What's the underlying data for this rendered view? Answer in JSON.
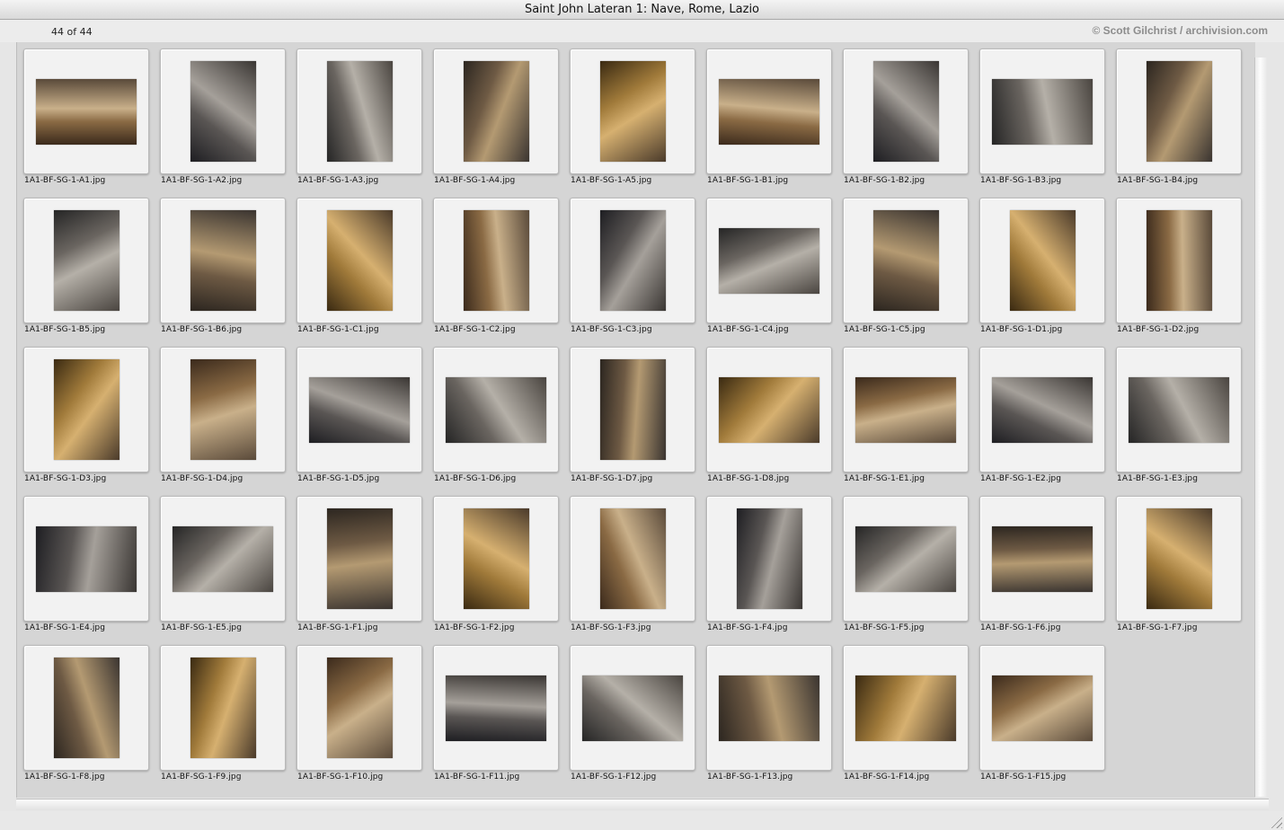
{
  "window": {
    "title": "Saint John Lateran 1: Nave, Rome, Lazio"
  },
  "header": {
    "count": "44 of 44",
    "credit": "© Scott Gilchrist / archivision.com"
  },
  "thumbnails": [
    {
      "file": "1A1-BF-SG-1-A1.jpg",
      "orientation": "landscape"
    },
    {
      "file": "1A1-BF-SG-1-A2.jpg",
      "orientation": "portrait"
    },
    {
      "file": "1A1-BF-SG-1-A3.jpg",
      "orientation": "portrait"
    },
    {
      "file": "1A1-BF-SG-1-A4.jpg",
      "orientation": "portrait"
    },
    {
      "file": "1A1-BF-SG-1-A5.jpg",
      "orientation": "portrait"
    },
    {
      "file": "1A1-BF-SG-1-B1.jpg",
      "orientation": "landscape"
    },
    {
      "file": "1A1-BF-SG-1-B2.jpg",
      "orientation": "portrait"
    },
    {
      "file": "1A1-BF-SG-1-B3.jpg",
      "orientation": "landscape"
    },
    {
      "file": "1A1-BF-SG-1-B4.jpg",
      "orientation": "portrait"
    },
    {
      "file": "1A1-BF-SG-1-B5.jpg",
      "orientation": "portrait"
    },
    {
      "file": "1A1-BF-SG-1-B6.jpg",
      "orientation": "portrait"
    },
    {
      "file": "1A1-BF-SG-1-C1.jpg",
      "orientation": "portrait"
    },
    {
      "file": "1A1-BF-SG-1-C2.jpg",
      "orientation": "portrait"
    },
    {
      "file": "1A1-BF-SG-1-C3.jpg",
      "orientation": "portrait"
    },
    {
      "file": "1A1-BF-SG-1-C4.jpg",
      "orientation": "landscape"
    },
    {
      "file": "1A1-BF-SG-1-C5.jpg",
      "orientation": "portrait"
    },
    {
      "file": "1A1-BF-SG-1-D1.jpg",
      "orientation": "portrait"
    },
    {
      "file": "1A1-BF-SG-1-D2.jpg",
      "orientation": "portrait"
    },
    {
      "file": "1A1-BF-SG-1-D3.jpg",
      "orientation": "portrait"
    },
    {
      "file": "1A1-BF-SG-1-D4.jpg",
      "orientation": "portrait"
    },
    {
      "file": "1A1-BF-SG-1-D5.jpg",
      "orientation": "landscape"
    },
    {
      "file": "1A1-BF-SG-1-D6.jpg",
      "orientation": "landscape"
    },
    {
      "file": "1A1-BF-SG-1-D7.jpg",
      "orientation": "portrait"
    },
    {
      "file": "1A1-BF-SG-1-D8.jpg",
      "orientation": "landscape"
    },
    {
      "file": "1A1-BF-SG-1-E1.jpg",
      "orientation": "landscape"
    },
    {
      "file": "1A1-BF-SG-1-E2.jpg",
      "orientation": "landscape"
    },
    {
      "file": "1A1-BF-SG-1-E3.jpg",
      "orientation": "landscape"
    },
    {
      "file": "1A1-BF-SG-1-E4.jpg",
      "orientation": "landscape"
    },
    {
      "file": "1A1-BF-SG-1-E5.jpg",
      "orientation": "landscape"
    },
    {
      "file": "1A1-BF-SG-1-F1.jpg",
      "orientation": "portrait"
    },
    {
      "file": "1A1-BF-SG-1-F2.jpg",
      "orientation": "portrait"
    },
    {
      "file": "1A1-BF-SG-1-F3.jpg",
      "orientation": "portrait"
    },
    {
      "file": "1A1-BF-SG-1-F4.jpg",
      "orientation": "portrait"
    },
    {
      "file": "1A1-BF-SG-1-F5.jpg",
      "orientation": "landscape"
    },
    {
      "file": "1A1-BF-SG-1-F6.jpg",
      "orientation": "landscape"
    },
    {
      "file": "1A1-BF-SG-1-F7.jpg",
      "orientation": "portrait"
    },
    {
      "file": "1A1-BF-SG-1-F8.jpg",
      "orientation": "portrait"
    },
    {
      "file": "1A1-BF-SG-1-F9.jpg",
      "orientation": "portrait"
    },
    {
      "file": "1A1-BF-SG-1-F10.jpg",
      "orientation": "portrait"
    },
    {
      "file": "1A1-BF-SG-1-F11.jpg",
      "orientation": "landscape"
    },
    {
      "file": "1A1-BF-SG-1-F12.jpg",
      "orientation": "landscape"
    },
    {
      "file": "1A1-BF-SG-1-F13.jpg",
      "orientation": "landscape"
    },
    {
      "file": "1A1-BF-SG-1-F14.jpg",
      "orientation": "landscape"
    },
    {
      "file": "1A1-BF-SG-1-F15.jpg",
      "orientation": "landscape"
    }
  ]
}
